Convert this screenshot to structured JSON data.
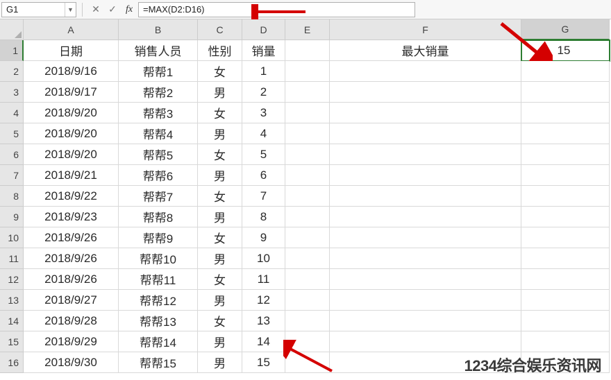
{
  "formula_bar": {
    "name_box": "G1",
    "formula": "=MAX(D2:D16)"
  },
  "columns": [
    "A",
    "B",
    "C",
    "D",
    "E",
    "F",
    "G"
  ],
  "selected_col": "G",
  "selected_row": "1",
  "headers": {
    "A": "日期",
    "B": "销售人员",
    "C": "性别",
    "D": "销量",
    "F": "最大销量"
  },
  "result_G1": "15",
  "rows": [
    {
      "n": "2",
      "date": "2018/9/16",
      "name": "帮帮1",
      "sex": "女",
      "qty": "1"
    },
    {
      "n": "3",
      "date": "2018/9/17",
      "name": "帮帮2",
      "sex": "男",
      "qty": "2"
    },
    {
      "n": "4",
      "date": "2018/9/20",
      "name": "帮帮3",
      "sex": "女",
      "qty": "3"
    },
    {
      "n": "5",
      "date": "2018/9/20",
      "name": "帮帮4",
      "sex": "男",
      "qty": "4"
    },
    {
      "n": "6",
      "date": "2018/9/20",
      "name": "帮帮5",
      "sex": "女",
      "qty": "5"
    },
    {
      "n": "7",
      "date": "2018/9/21",
      "name": "帮帮6",
      "sex": "男",
      "qty": "6"
    },
    {
      "n": "8",
      "date": "2018/9/22",
      "name": "帮帮7",
      "sex": "女",
      "qty": "7"
    },
    {
      "n": "9",
      "date": "2018/9/23",
      "name": "帮帮8",
      "sex": "男",
      "qty": "8"
    },
    {
      "n": "10",
      "date": "2018/9/26",
      "name": "帮帮9",
      "sex": "女",
      "qty": "9"
    },
    {
      "n": "11",
      "date": "2018/9/26",
      "name": "帮帮10",
      "sex": "男",
      "qty": "10"
    },
    {
      "n": "12",
      "date": "2018/9/26",
      "name": "帮帮11",
      "sex": "女",
      "qty": "11"
    },
    {
      "n": "13",
      "date": "2018/9/27",
      "name": "帮帮12",
      "sex": "男",
      "qty": "12"
    },
    {
      "n": "14",
      "date": "2018/9/28",
      "name": "帮帮13",
      "sex": "女",
      "qty": "13"
    },
    {
      "n": "15",
      "date": "2018/9/29",
      "name": "帮帮14",
      "sex": "男",
      "qty": "14"
    },
    {
      "n": "16",
      "date": "2018/9/30",
      "name": "帮帮15",
      "sex": "男",
      "qty": "15"
    }
  ],
  "watermark": "1234综合娱乐资讯网"
}
